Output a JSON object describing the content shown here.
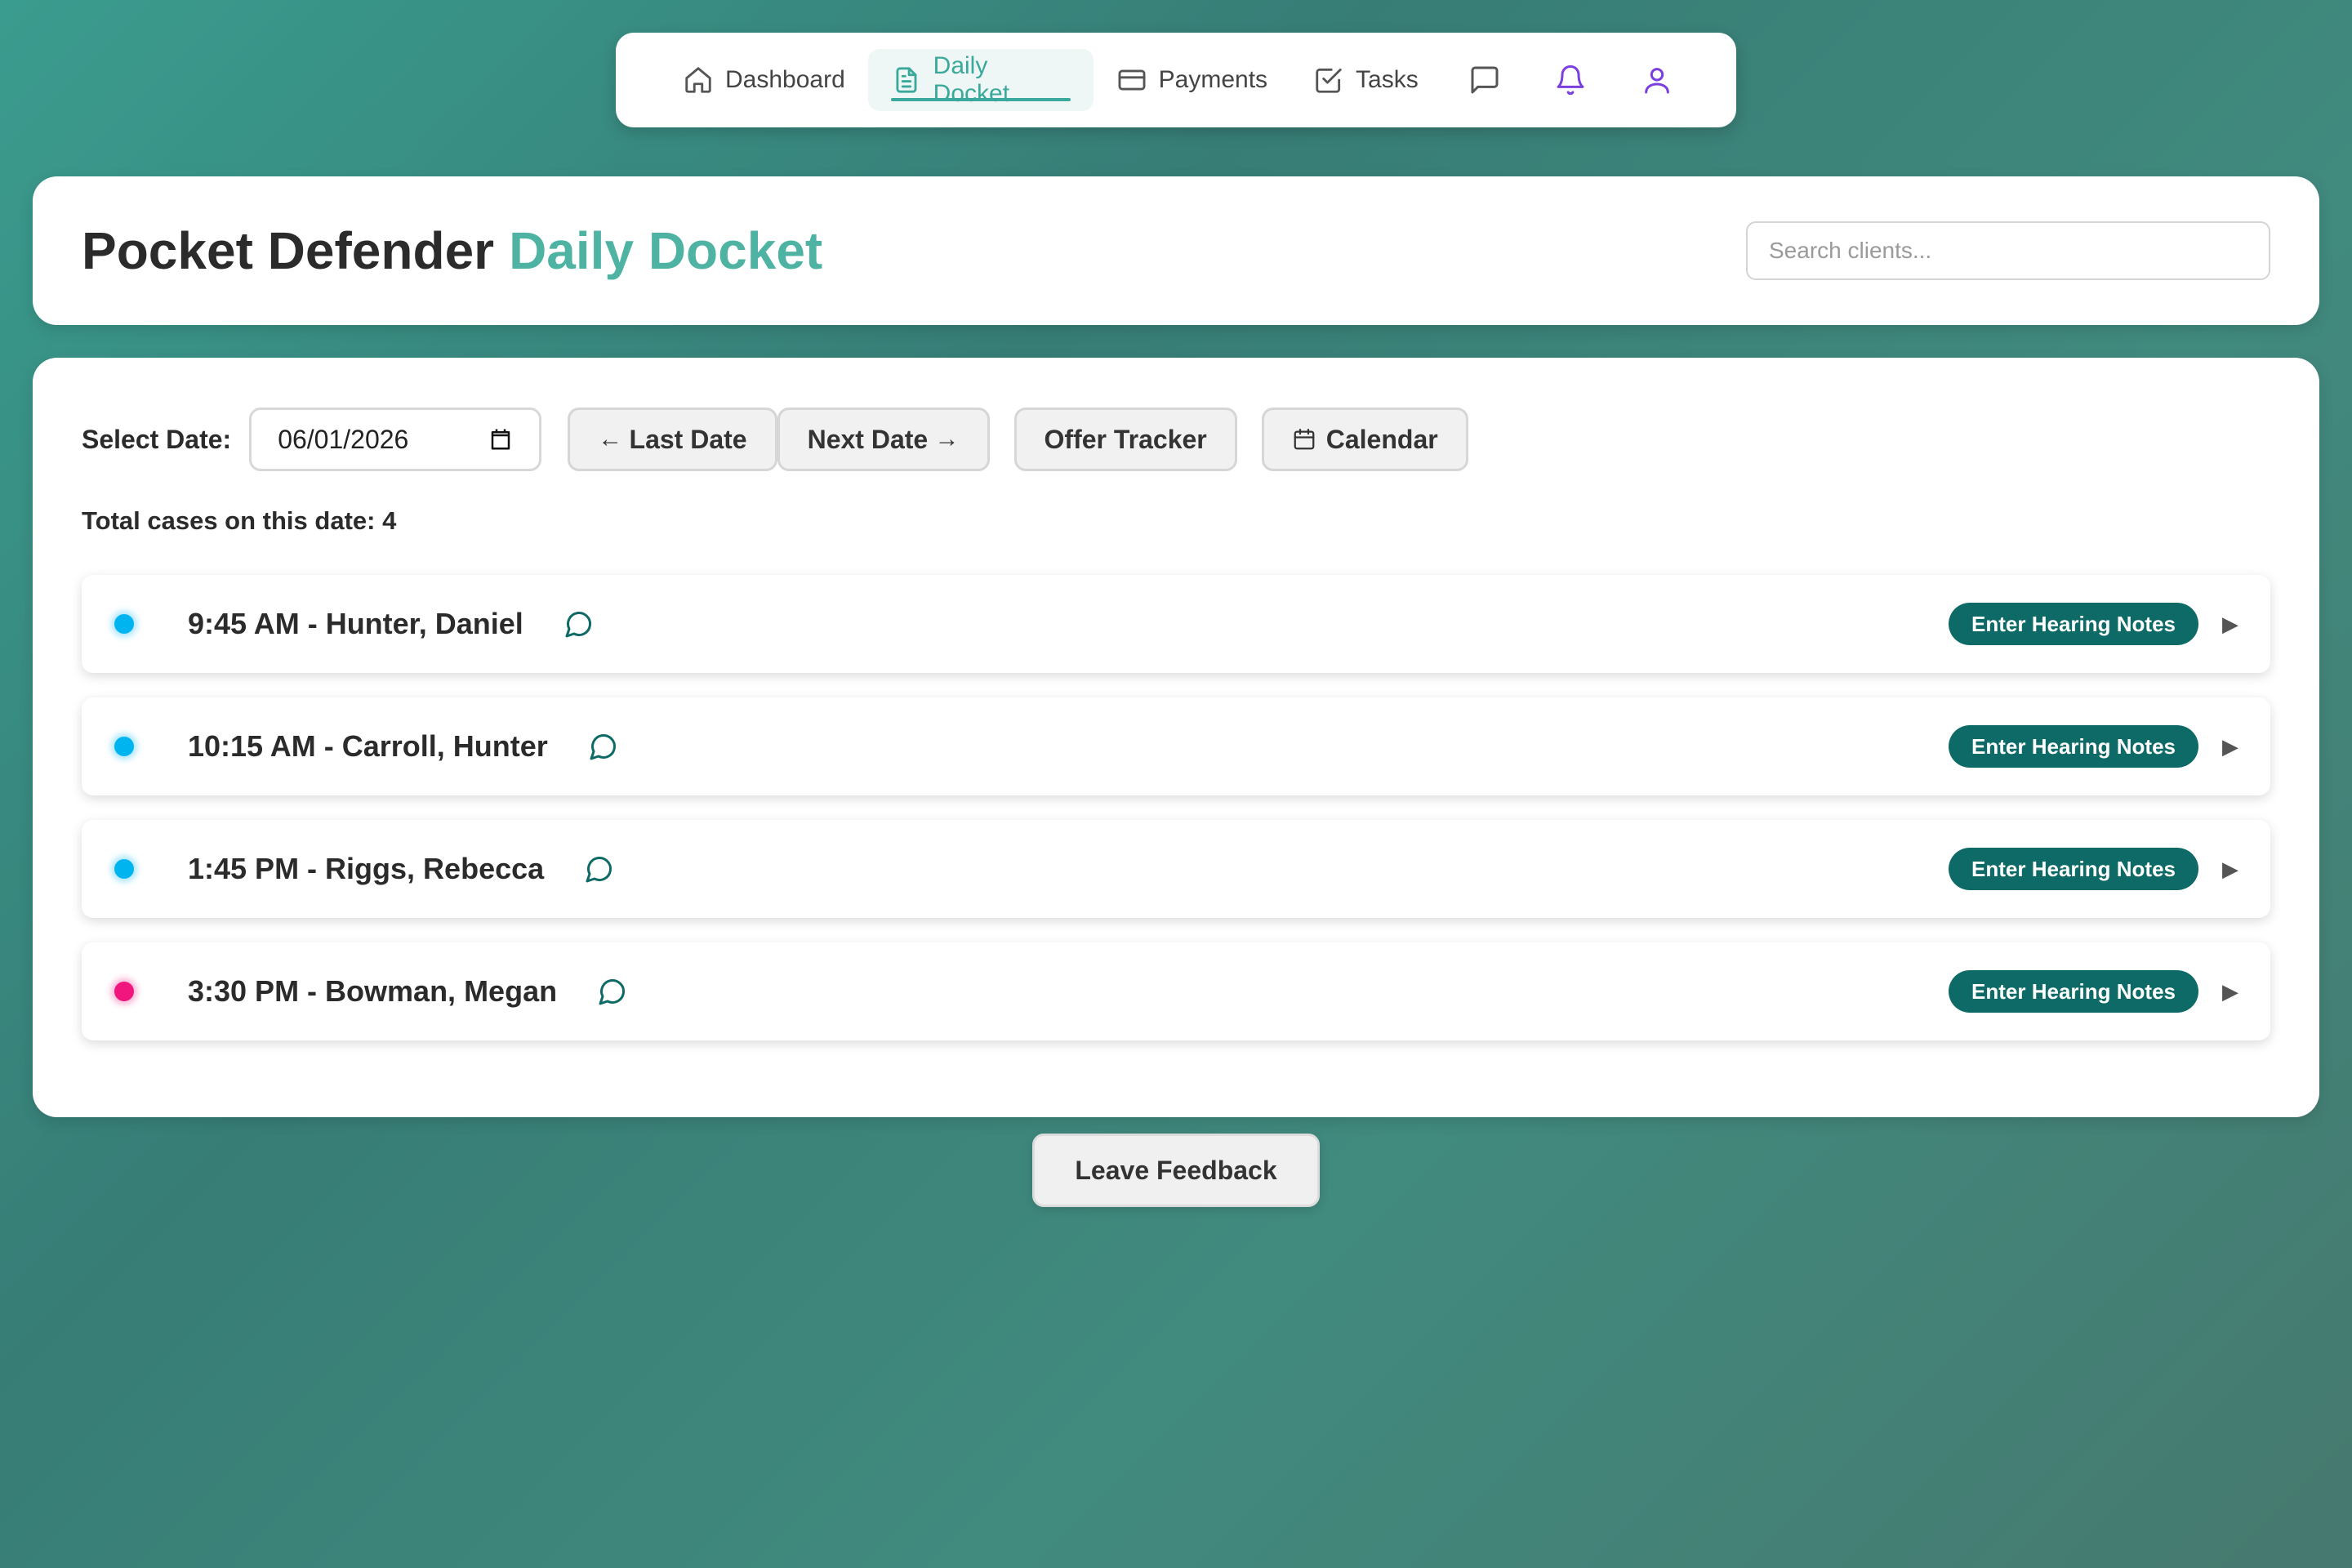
{
  "nav": {
    "items": [
      {
        "label": "Dashboard",
        "icon": "home-icon"
      },
      {
        "label": "Daily Docket",
        "icon": "document-icon",
        "active": true
      },
      {
        "label": "Payments",
        "icon": "credit-card-icon"
      },
      {
        "label": "Tasks",
        "icon": "checkbox-icon"
      }
    ],
    "icons": [
      "chat-icon",
      "bell-icon",
      "user-icon"
    ],
    "accent_color": "#3aa89a",
    "icon_purple": "#7b3fe0"
  },
  "header": {
    "title_main": "Pocket Defender",
    "title_accent": "Daily Docket",
    "search_placeholder": "Search clients..."
  },
  "toolbar": {
    "date_label": "Select Date:",
    "date_value": "06/01/2026",
    "last_date_label": "Last Date",
    "next_date_label": "Next Date",
    "offer_tracker_label": "Offer Tracker",
    "calendar_label": "Calendar"
  },
  "summary": {
    "total_text": "Total cases on this date: 4"
  },
  "cases": [
    {
      "label": "9:45 AM - Hunter, Daniel",
      "status_color": "#00b4f0",
      "notes_label": "Enter Hearing Notes"
    },
    {
      "label": "10:15 AM - Carroll, Hunter",
      "status_color": "#00b4f0",
      "notes_label": "Enter Hearing Notes"
    },
    {
      "label": "1:45 PM - Riggs, Rebecca",
      "status_color": "#00b4f0",
      "notes_label": "Enter Hearing Notes"
    },
    {
      "label": "3:30 PM - Bowman, Megan",
      "status_color": "#f0167e",
      "notes_label": "Enter Hearing Notes"
    }
  ],
  "footer": {
    "feedback_label": "Leave Feedback"
  },
  "colors": {
    "notes_button": "#0e6a66",
    "title_accent": "#4fb3a3"
  }
}
